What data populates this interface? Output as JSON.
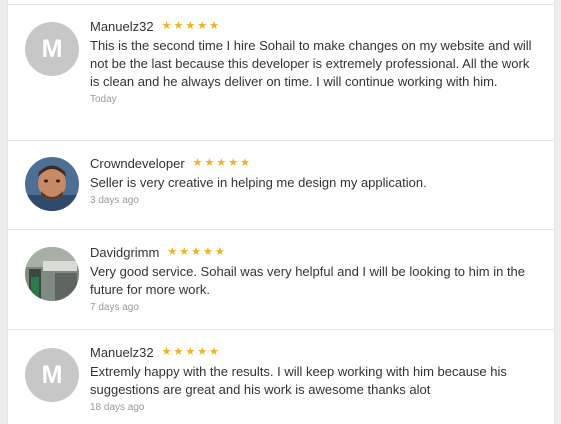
{
  "reviews": [
    {
      "username": "Manuelz32",
      "avatar_letter": "M",
      "rating": 5,
      "text": "This is the second time I hire Sohail to make changes on my website and will not be the last because this developer is extremely professional. All the work is clean and he always deliver on time. I will continue working with him.",
      "date": "Today"
    },
    {
      "username": "Crowndeveloper",
      "rating": 5,
      "text": "Seller is very creative in helping me design my application.",
      "date": "3 days ago"
    },
    {
      "username": "Davidgrimm",
      "rating": 5,
      "text": "Very good service. Sohail was very helpful and I will be looking to him in the future for more work.",
      "date": "7 days ago"
    },
    {
      "username": "Manuelz32",
      "avatar_letter": "M",
      "rating": 5,
      "text": "Extremly happy with the results. I will keep working with him because his suggestions are great and his work is awesome thanks alot",
      "date": "18 days ago"
    }
  ],
  "colors": {
    "star": "#f1b21a",
    "avatar_placeholder": "#c7c7c7",
    "date_text": "#999999"
  },
  "icons": {
    "star": "star-icon"
  }
}
